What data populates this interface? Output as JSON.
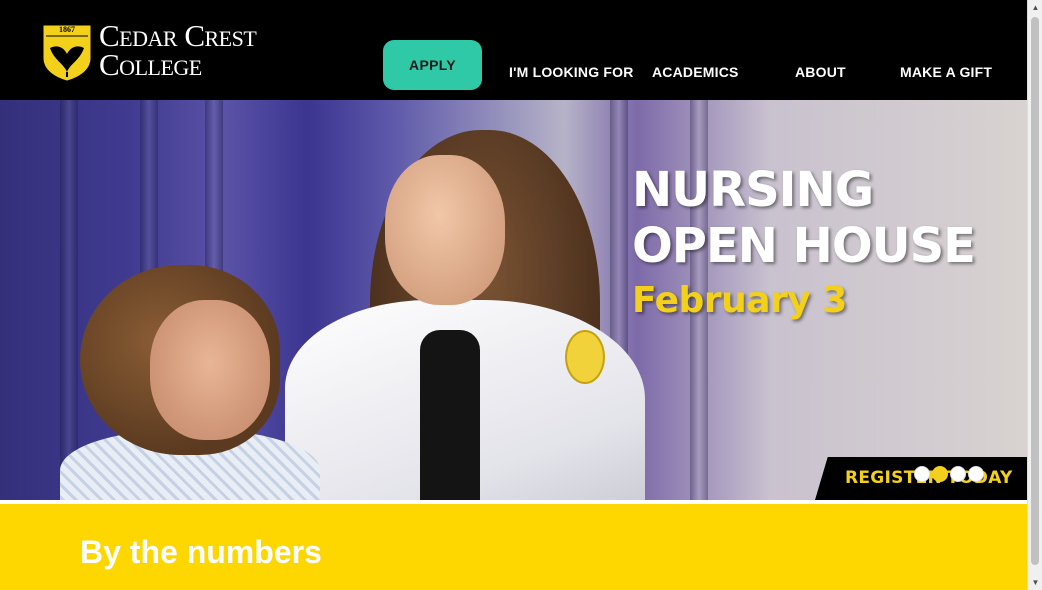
{
  "header": {
    "logo": {
      "year": "1867",
      "line1": "Cedar Crest",
      "line2": "College"
    },
    "apply_label": "APPLY",
    "nav": [
      {
        "label": "I'M LOOKING FOR"
      },
      {
        "label": "ACADEMICS"
      },
      {
        "label": "ABOUT"
      },
      {
        "label": "MAKE A GIFT"
      }
    ]
  },
  "hero": {
    "line1": "NURSING",
    "line2": "OPEN HOUSE",
    "date": "February 3",
    "register_label": "REGISTER TODAY",
    "slides": {
      "count": 4,
      "active_index": 1
    }
  },
  "numbers": {
    "title": "By the numbers"
  },
  "colors": {
    "header_bg": "#000000",
    "apply_bg": "#2fc9a8",
    "accent_yellow": "#fed700",
    "hero_date": "#f3d11b"
  },
  "icons": {
    "scroll_up": "triangle-up-icon",
    "scroll_down": "triangle-down-icon",
    "crest": "ginkgo-leaf-shield-icon"
  }
}
